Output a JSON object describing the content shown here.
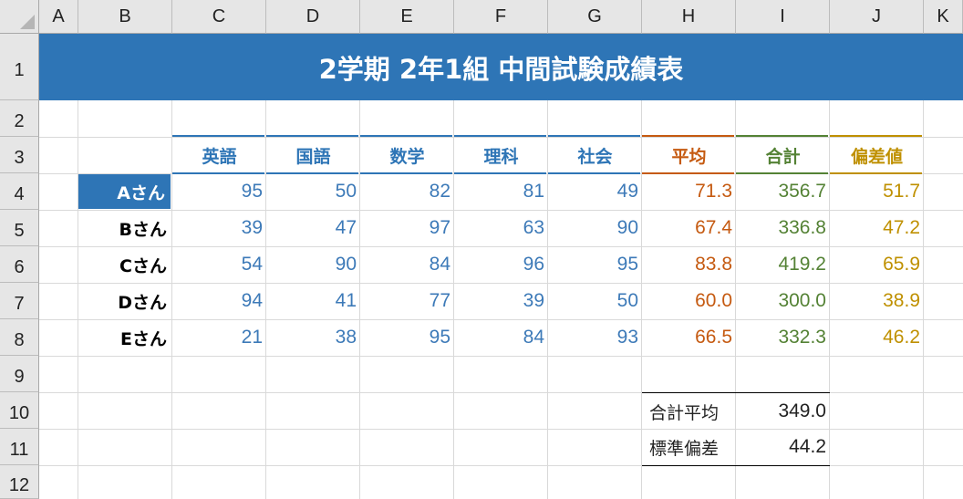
{
  "columns": [
    "A",
    "B",
    "C",
    "D",
    "E",
    "F",
    "G",
    "H",
    "I",
    "J",
    "K"
  ],
  "rows": [
    "1",
    "2",
    "3",
    "4",
    "5",
    "6",
    "7",
    "8",
    "9",
    "10",
    "11",
    "12"
  ],
  "title": "2学期 2年1組 中間試験成績表",
  "headers": {
    "subjects": [
      "英語",
      "国語",
      "数学",
      "理科",
      "社会"
    ],
    "average": "平均",
    "total": "合計",
    "deviation": "偏差値"
  },
  "students": [
    {
      "name": "Aさん",
      "scores": [
        "95",
        "50",
        "82",
        "81",
        "49"
      ],
      "average": "71.3",
      "total": "356.7",
      "deviation": "51.7"
    },
    {
      "name": "Bさん",
      "scores": [
        "39",
        "47",
        "97",
        "63",
        "90"
      ],
      "average": "67.4",
      "total": "336.8",
      "deviation": "47.2"
    },
    {
      "name": "Cさん",
      "scores": [
        "54",
        "90",
        "84",
        "96",
        "95"
      ],
      "average": "83.8",
      "total": "419.2",
      "deviation": "65.9"
    },
    {
      "name": "Dさん",
      "scores": [
        "94",
        "41",
        "77",
        "39",
        "50"
      ],
      "average": "60.0",
      "total": "300.0",
      "deviation": "38.9"
    },
    {
      "name": "Eさん",
      "scores": [
        "21",
        "38",
        "95",
        "84",
        "93"
      ],
      "average": "66.5",
      "total": "332.3",
      "deviation": "46.2"
    }
  ],
  "summary": {
    "total_average_label": "合計平均",
    "total_average_value": "349.0",
    "std_dev_label": "標準偏差",
    "std_dev_value": "44.2"
  },
  "colors": {
    "header_blue": "#2e75b6",
    "average_orange": "#c55a11",
    "total_green": "#548235",
    "deviation_gold": "#bf9000"
  }
}
